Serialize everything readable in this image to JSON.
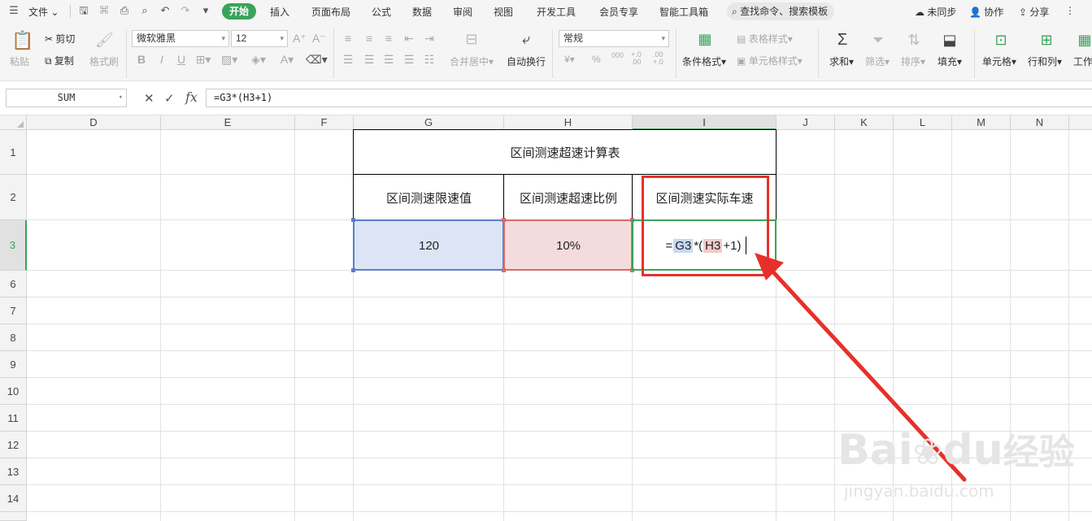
{
  "menubar": {
    "file_label": "文件",
    "tabs": [
      {
        "label": "开始",
        "active": true
      },
      {
        "label": "插入"
      },
      {
        "label": "页面布局"
      },
      {
        "label": "公式"
      },
      {
        "label": "数据"
      },
      {
        "label": "审阅"
      },
      {
        "label": "视图"
      },
      {
        "label": "开发工具"
      },
      {
        "label": "会员专享"
      },
      {
        "label": "智能工具箱"
      }
    ],
    "search_placeholder": "查找命令、搜索模板",
    "sync_label": "未同步",
    "collab_label": "协作",
    "share_label": "分享"
  },
  "ribbon": {
    "paste": "粘贴",
    "cut": "剪切",
    "copy": "复制",
    "format_painter": "格式刷",
    "font_name": "微软雅黑",
    "font_size": "12",
    "merge_center": "合并居中",
    "auto_wrap": "自动换行",
    "number_format": "常规",
    "currency": "¥",
    "percent": "%",
    "thousands": "000",
    "inc_decimal": "+.0 .00",
    "dec_decimal": ".00 +.0",
    "conditional_format": "条件格式",
    "table_style": "表格样式",
    "cell_style": "单元格样式",
    "sum": "求和",
    "filter": "筛选",
    "sort": "排序",
    "fill": "填充",
    "cells": "单元格",
    "row_col": "行和列",
    "worksheet": "工作"
  },
  "formula_bar": {
    "name_box": "SUM",
    "cancel": "✕",
    "confirm": "✓",
    "fx": "fx",
    "formula": "=G3*(H3+1)"
  },
  "columns": [
    "D",
    "E",
    "F",
    "G",
    "H",
    "I",
    "J",
    "K",
    "L",
    "M",
    "N"
  ],
  "rows": [
    "1",
    "2",
    "3",
    "6",
    "7",
    "8",
    "9",
    "10",
    "11",
    "12",
    "13",
    "14"
  ],
  "table": {
    "title": "区间测速超速计算表",
    "headers": [
      "区间测速限速值",
      "区间测速超速比例",
      "区间测速实际车速"
    ],
    "values": [
      "120",
      "10%"
    ],
    "editing": {
      "eq": "=",
      "ref1": "G3",
      "op1": "*(",
      "ref2": "H3",
      "op2": "+1)"
    }
  },
  "watermark": {
    "brand": "Bai",
    "brand2": "du",
    "cn": "经验",
    "url": "jingyan.baidu.com"
  },
  "colors": {
    "accent_green": "#3aa35b",
    "highlight_red": "#e8302a",
    "ref_blue": "#dce4f5",
    "ref_pink": "#f4dcdc"
  }
}
